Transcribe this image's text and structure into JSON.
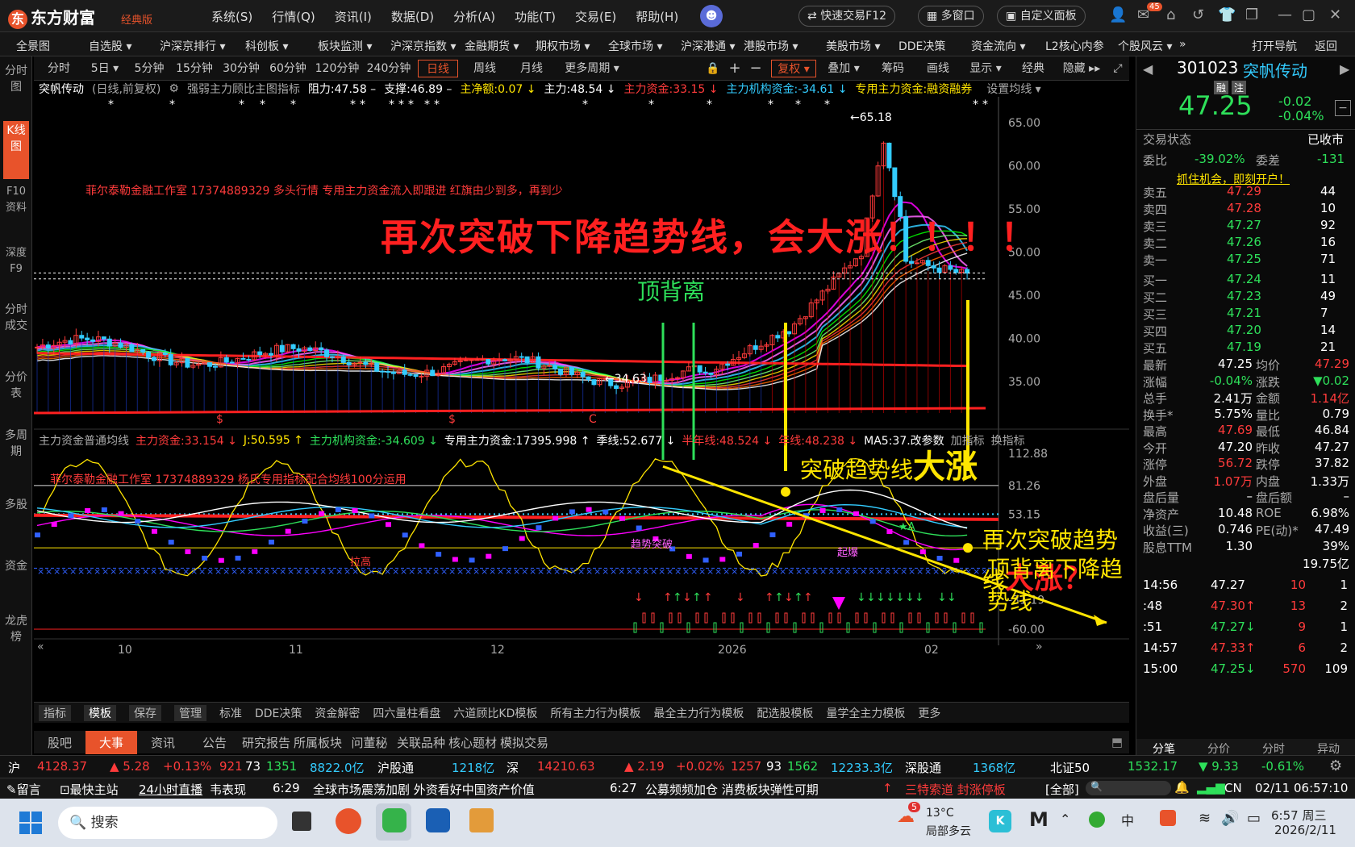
{
  "app": {
    "logo": "东方财富",
    "edition": "经典版",
    "menus": [
      "系统(S)",
      "行情(Q)",
      "资讯(I)",
      "数据(D)",
      "分析(A)",
      "功能(T)",
      "交易(E)",
      "帮助(H)"
    ],
    "quick_trade": "快速交易F12",
    "multi_window": "多窗口",
    "custom_panel": "自定义面板",
    "mail_badge": "45"
  },
  "nav": [
    "全景图",
    "自选股 ▾",
    "沪深京排行 ▾",
    "科创板 ▾",
    "板块监测 ▾",
    "沪深京指数 ▾",
    "金融期货 ▾",
    "期权市场 ▾",
    "全球市场 ▾",
    "沪深港通 ▾",
    "港股市场 ▾",
    "美股市场 ▾",
    "DDE决策",
    "资金流向 ▾",
    "L2核心内参",
    "个股风云 ▾",
    "»",
    "打开导航",
    "返回"
  ],
  "sidebar": [
    "分时图",
    "K线图",
    "F10资料",
    "深度F9",
    "分时成交",
    "分价表",
    "多周期",
    "多股",
    "资金",
    "龙虎榜"
  ],
  "periods": [
    "分时",
    "5日 ▾",
    "5分钟",
    "15分钟",
    "30分钟",
    "60分钟",
    "120分钟",
    "240分钟",
    "日线",
    "周线",
    "月线",
    "更多周期 ▾"
  ],
  "tools": [
    "复权 ▾",
    "叠加 ▾",
    "筹码",
    "画线",
    "显示 ▾",
    "经典",
    "隐藏 ▸▸"
  ],
  "main_indicator": {
    "name": "突帆传动",
    "mode": "(日线,前复权)",
    "indicator": "强弱主力顾比主图指标",
    "resist": "阻力:47.58 –",
    "support": "支撑:46.89 –",
    "net": "主净额:0.07 ↓",
    "main": "主力:48.54 ↓",
    "main_fund": "主力资金:33.15 ↓",
    "inst_fund": "主力机构资金:-34.61 ↓",
    "special": "专用主力资金:融资融券",
    "setting": "设置均线 ▾"
  },
  "annotations": {
    "studio": "菲尔泰勒金融工作室 17374889329 多头行情 专用主力资金流入即跟进 红旗由少到多，再到少",
    "headline": "再次突破下降趋势线，会大涨！！！！",
    "top_div": "顶背离",
    "break": "突破趋势线",
    "big_rise": "大涨",
    "rebreak": "再次突破趋势线",
    "big_rise_q": "大涨？",
    "top_div_down": "顶背离下降趋势线",
    "high_label": "65.18",
    "low_label": "34.63",
    "studio2": "菲尔泰勒金融工作室 17374889329 杨氏专用指标配合均线100分运用",
    "trend_break": "趋势突破",
    "rally": "起爆",
    "star_a": "★A",
    "pull": "拉高",
    "marks": [
      "$",
      "$",
      "C"
    ]
  },
  "sub_indicator": {
    "name": "主力资金普通均线",
    "main_fund": "主力资金:33.154 ↓",
    "j": "J:50.595 ↑",
    "inst": "主力机构资金:-34.609 ↓",
    "special": "专用主力资金:17395.998 ↑",
    "season": "季线:52.677 ↓",
    "half": "半年线:48.524 ↓",
    "year": "年线:48.238 ↓",
    "ma": "MA5:37.改参数",
    "add": "加指标",
    "switch": "换指标"
  },
  "y_main": [
    "65.00",
    "60.00",
    "55.00",
    "50.00",
    "45.00",
    "40.00",
    "35.00"
  ],
  "y_sub": [
    "112.88",
    "81.26",
    "53.15",
    "-31.19",
    "-60.00"
  ],
  "x_axis": [
    "10",
    "11",
    "12",
    "2026",
    "02"
  ],
  "template_tabs": [
    "指标",
    "模板",
    "保存",
    "管理",
    "标准",
    "DDE决策",
    "资金解密",
    "四六量柱看盘",
    "六道顾比KD模板",
    "所有主力行为模板",
    "最全主力行为模板",
    "配选股模板",
    "量学全主力模板",
    "更多"
  ],
  "bottom_tabs": [
    "股吧",
    "大事",
    "资讯",
    "公告",
    "研究报告",
    "所属板块",
    "问董秘",
    "关联品种",
    "核心题材",
    "模拟交易"
  ],
  "quote": {
    "code": "301023",
    "name": "突帆传动",
    "tags": [
      "融",
      "注"
    ],
    "price": "47.25",
    "chg": "-0.02",
    "pct": "-0.04%",
    "trade_state_label": "交易状态",
    "trade_state": "已收市",
    "wb_label": "委比",
    "wb": "-39.02%",
    "wc_label": "委差",
    "wc": "-131",
    "promo": "抓住机会，即刻开户！",
    "asks": [
      [
        "卖五",
        "47.29",
        "44"
      ],
      [
        "卖四",
        "47.28",
        "10"
      ],
      [
        "卖三",
        "47.27",
        "92"
      ],
      [
        "卖二",
        "47.26",
        "16"
      ],
      [
        "卖一",
        "47.25",
        "71"
      ]
    ],
    "bids": [
      [
        "买一",
        "47.24",
        "11"
      ],
      [
        "买二",
        "47.23",
        "49"
      ],
      [
        "买三",
        "47.21",
        "7"
      ],
      [
        "买四",
        "47.20",
        "14"
      ],
      [
        "买五",
        "47.19",
        "21"
      ]
    ],
    "stats": [
      [
        "最新",
        "47.25",
        "均价",
        "47.29"
      ],
      [
        "涨幅",
        "-0.04%",
        "涨跌",
        "▼0.02"
      ],
      [
        "总手",
        "2.41万",
        "金额",
        "1.14亿"
      ],
      [
        "换手*",
        "5.75%",
        "量比",
        "0.79"
      ],
      [
        "最高",
        "47.69",
        "最低",
        "46.84"
      ],
      [
        "今开",
        "47.20",
        "昨收",
        "47.27"
      ],
      [
        "涨停",
        "56.72",
        "跌停",
        "37.82"
      ],
      [
        "外盘",
        "1.07万",
        "内盘",
        "1.33万"
      ],
      [
        "盘后量",
        "–",
        "盘后额",
        "–"
      ],
      [
        "净资产",
        "10.48",
        "ROE",
        "6.98%"
      ],
      [
        "收益(三)",
        "0.746",
        "PE(动)*",
        "47.49"
      ],
      [
        "股息TTM",
        "1.30",
        "",
        "39%"
      ],
      [
        "",
        "",
        "",
        "19.75亿"
      ]
    ],
    "ticks": [
      [
        "14:56",
        "47.27",
        "10",
        "1"
      ],
      [
        ":48",
        "47.30↑",
        "13",
        "2"
      ],
      [
        ":51",
        "47.27↓",
        "9",
        "1"
      ],
      [
        "14:57",
        "47.33↑",
        "6",
        "2"
      ],
      [
        "15:00",
        "47.25↓",
        "570",
        "109"
      ]
    ],
    "tabs": [
      "分笔",
      "分价",
      "分时",
      "异动"
    ]
  },
  "status": {
    "sh_label": "沪",
    "sh": "4128.37",
    "sh_chg": "▲ 5.28",
    "sh_pct": "+0.13%",
    "sh_up": "921",
    "sh_flat": "73",
    "sh_dn": "1351",
    "sh_amt": "8822.0亿",
    "hgt_label": "沪股通",
    "hgt": "1218亿",
    "sz_label": "深",
    "sz": "14210.63",
    "sz_chg": "▲ 2.19",
    "sz_pct": "+0.02%",
    "sz_up": "1257",
    "sz_flat": "93",
    "sz_dn": "1562",
    "sz_amt": "12233.3亿",
    "sgt_label": "深股通",
    "sgt": "1368亿",
    "bz_label": "北证50",
    "bz": "1532.17",
    "bz_chg": "▼ 9.33",
    "bz_pct": "-0.61%"
  },
  "news": {
    "msg": "留言",
    "home": "最快主站",
    "live": "24小时直播",
    "live_title": "韦表现",
    "t1": "6:29",
    "n1": "全球市场震荡加剧 外资看好中国资产价值",
    "t2": "6:27",
    "n2": "公募频频加仓 消费板块弹性可期",
    "n3": "三特索道 封涨停板",
    "all": "[全部]",
    "region": "CN",
    "date": "02/11",
    "time": "06:57:10"
  },
  "taskbar": {
    "search": "搜索",
    "weather_temp": "13°C",
    "weather_desc": "局部多云",
    "ime": "中",
    "time": "6:57 周三",
    "date": "2026/2/11",
    "badge": "5"
  },
  "colors": {
    "accent": "#e8532b",
    "up": "#ff3b3b",
    "down": "#2ee05a",
    "yellow": "#ffe500"
  }
}
